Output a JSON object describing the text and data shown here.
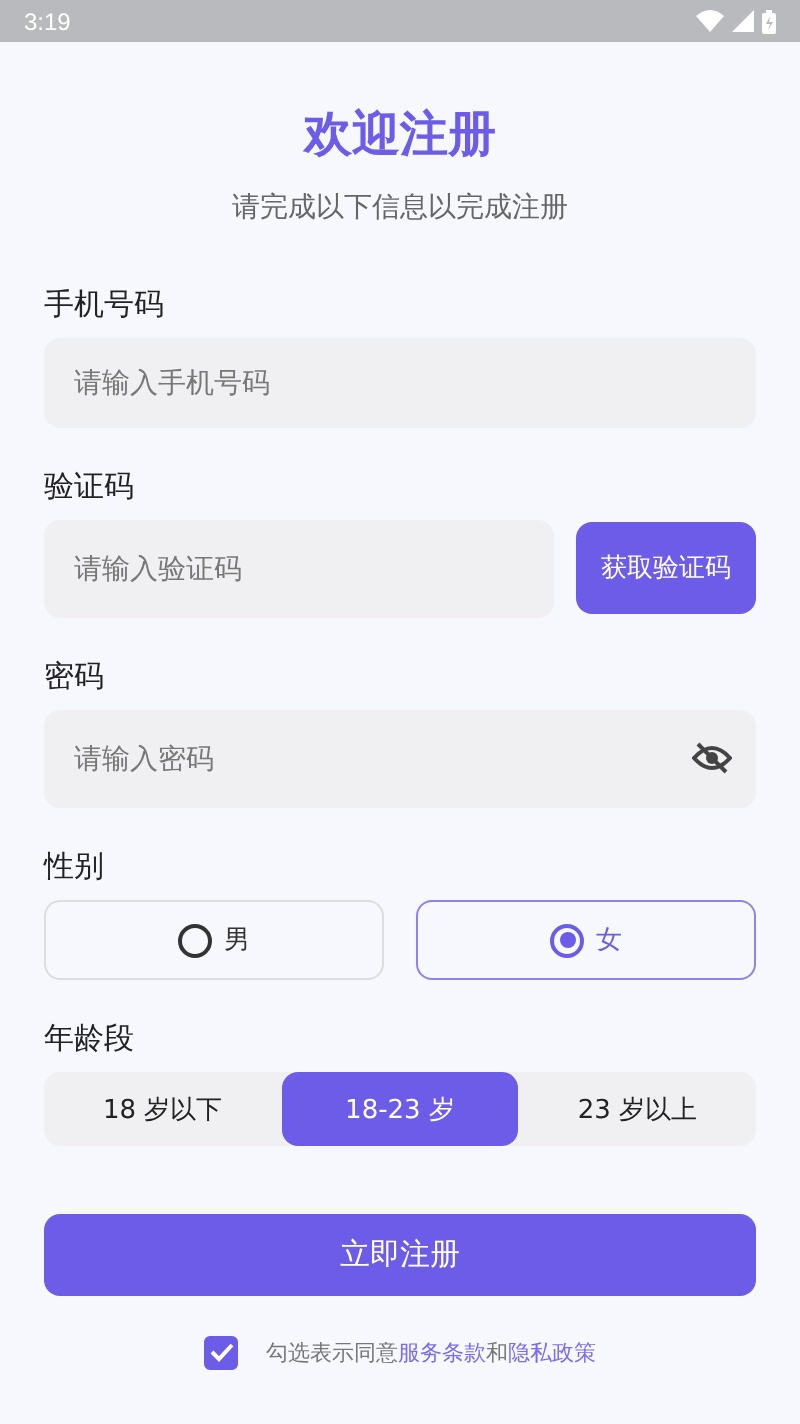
{
  "status_bar": {
    "time": "3:19"
  },
  "header": {
    "title": "欢迎注册",
    "subtitle": "请完成以下信息以完成注册"
  },
  "phone": {
    "label": "手机号码",
    "placeholder": "请输入手机号码"
  },
  "code": {
    "label": "验证码",
    "placeholder": "请输入验证码",
    "button": "获取验证码"
  },
  "password": {
    "label": "密码",
    "placeholder": "请输入密码",
    "visible": false
  },
  "gender": {
    "label": "性别",
    "options": [
      {
        "label": "男",
        "selected": false
      },
      {
        "label": "女",
        "selected": true
      }
    ]
  },
  "age": {
    "label": "年龄段",
    "options": [
      {
        "label": "18 岁以下",
        "selected": false
      },
      {
        "label": "18-23 岁",
        "selected": true
      },
      {
        "label": "23 岁以上",
        "selected": false
      }
    ]
  },
  "submit": "立即注册",
  "agreement": {
    "checked": true,
    "parts": [
      {
        "kind": "text",
        "text": "勾选表示同意"
      },
      {
        "kind": "link",
        "text": "服务条款"
      },
      {
        "kind": "text",
        "text": "和"
      },
      {
        "kind": "link",
        "text": "隐私政策"
      }
    ]
  }
}
